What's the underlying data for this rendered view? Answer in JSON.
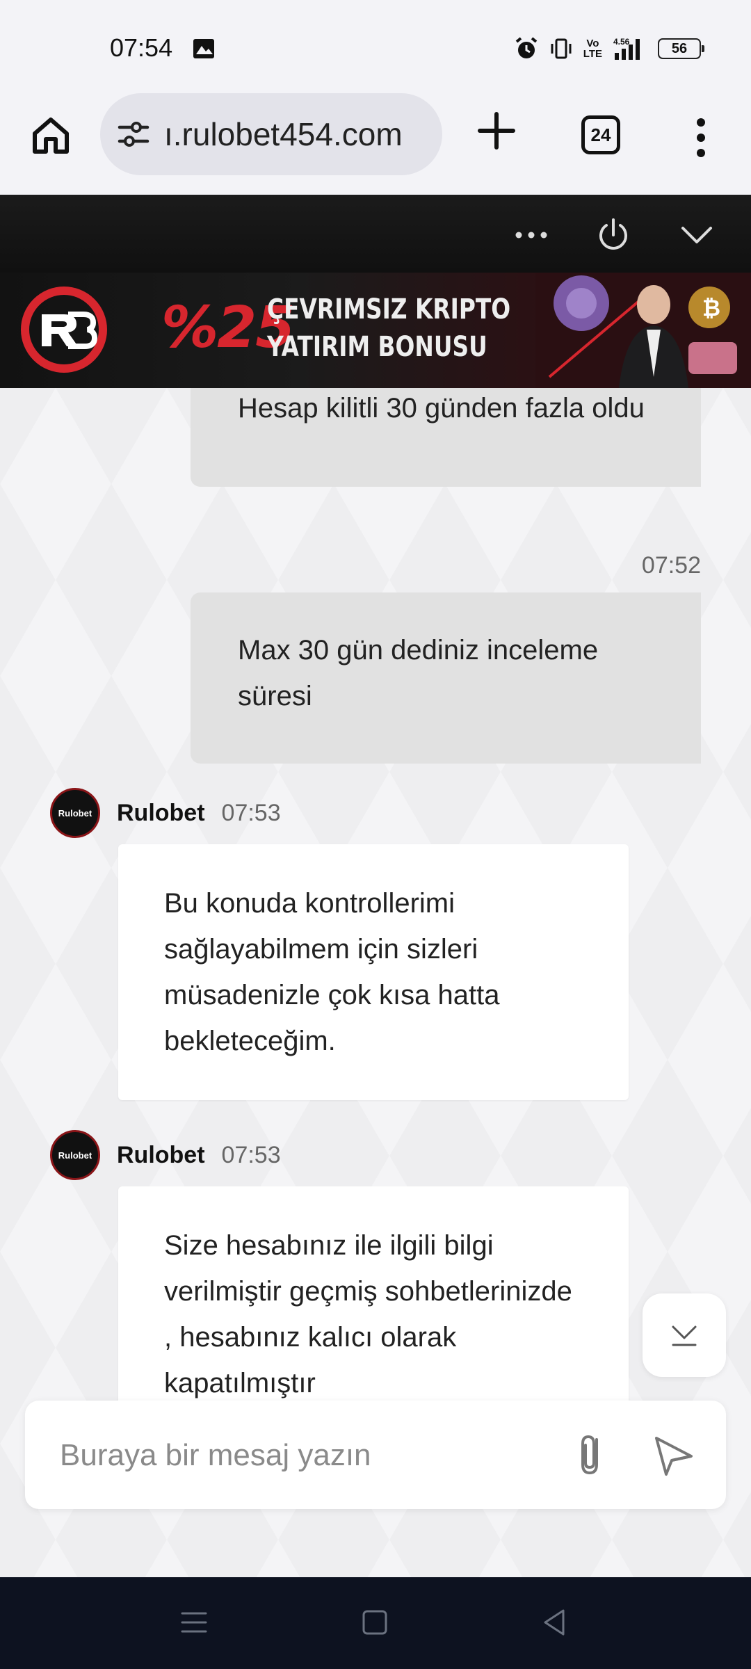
{
  "status_bar": {
    "time": "07:54",
    "network_label": "Vo\nLTE",
    "signal_speed": "4.56",
    "battery_level": "56"
  },
  "browser": {
    "url": "ı.rulobet454.com",
    "tab_count": "24"
  },
  "banner": {
    "percent": "%25",
    "line1": "ÇEVRIMSIZ KRIPTO",
    "line2": "YATIRIM BONUSU"
  },
  "chat": {
    "messages": [
      {
        "side": "out",
        "text": "Hesap kilitli 30 günden fazla oldu"
      },
      {
        "side": "out",
        "time": "07:52",
        "text": "Max 30 gün dediniz inceleme süresi"
      },
      {
        "side": "in",
        "sender": "Rulobet",
        "time": "07:53",
        "text": "Bu konuda kontrollerimi sağlayabilmem için sizleri müsadenizle çok kısa hatta bekleteceğim."
      },
      {
        "side": "in",
        "sender": "Rulobet",
        "time": "07:53",
        "text": "Size hesabınız ile ilgili bilgi verilmiştir geçmiş sohbetlerinizde , hesabınız kalıcı olarak kapatılmıştır"
      }
    ],
    "avatar_text": "Rulobet"
  },
  "composer": {
    "placeholder": "Buraya bir mesaj yazın"
  },
  "colors": {
    "brand_red": "#d7262e",
    "header_bg": "#151515",
    "outgoing_bubble": "#e1e1e1",
    "incoming_bubble": "#ffffff",
    "nav_bg": "#0d1220"
  },
  "icons": [
    "home-icon",
    "site-settings-icon",
    "plus-icon",
    "more-vert-icon",
    "more-horiz-icon",
    "power-icon",
    "chevron-down-icon",
    "attach-icon",
    "send-icon",
    "scroll-down-icon",
    "menu-icon",
    "square-icon",
    "back-icon"
  ]
}
